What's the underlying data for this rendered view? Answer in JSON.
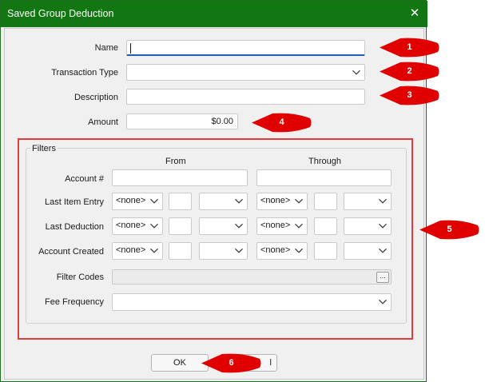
{
  "window": {
    "title": "Saved Group Deduction",
    "close_icon": "close-icon"
  },
  "form": {
    "name_label": "Name",
    "name_value": "",
    "transaction_type_label": "Transaction Type",
    "transaction_type_value": "",
    "description_label": "Description",
    "description_value": "",
    "amount_label": "Amount",
    "amount_value": "$0.00"
  },
  "filters": {
    "title": "Filters",
    "from_label": "From",
    "through_label": "Through",
    "account_number_label": "Account #",
    "last_item_entry_label": "Last Item Entry",
    "last_deduction_label": "Last Deduction",
    "account_created_label": "Account Created",
    "filter_codes_label": "Filter Codes",
    "fee_frequency_label": "Fee Frequency",
    "none_option": "<none>",
    "ellipsis": "..."
  },
  "buttons": {
    "ok_label": "OK",
    "cancel_partial": "l"
  },
  "callouts": [
    "1",
    "2",
    "3",
    "4",
    "5",
    "6"
  ],
  "colors": {
    "titlebar": "#127712",
    "callout_red": "#e00000",
    "highlight_box": "#e23b3b",
    "focus_underline": "#1f5fb0"
  }
}
